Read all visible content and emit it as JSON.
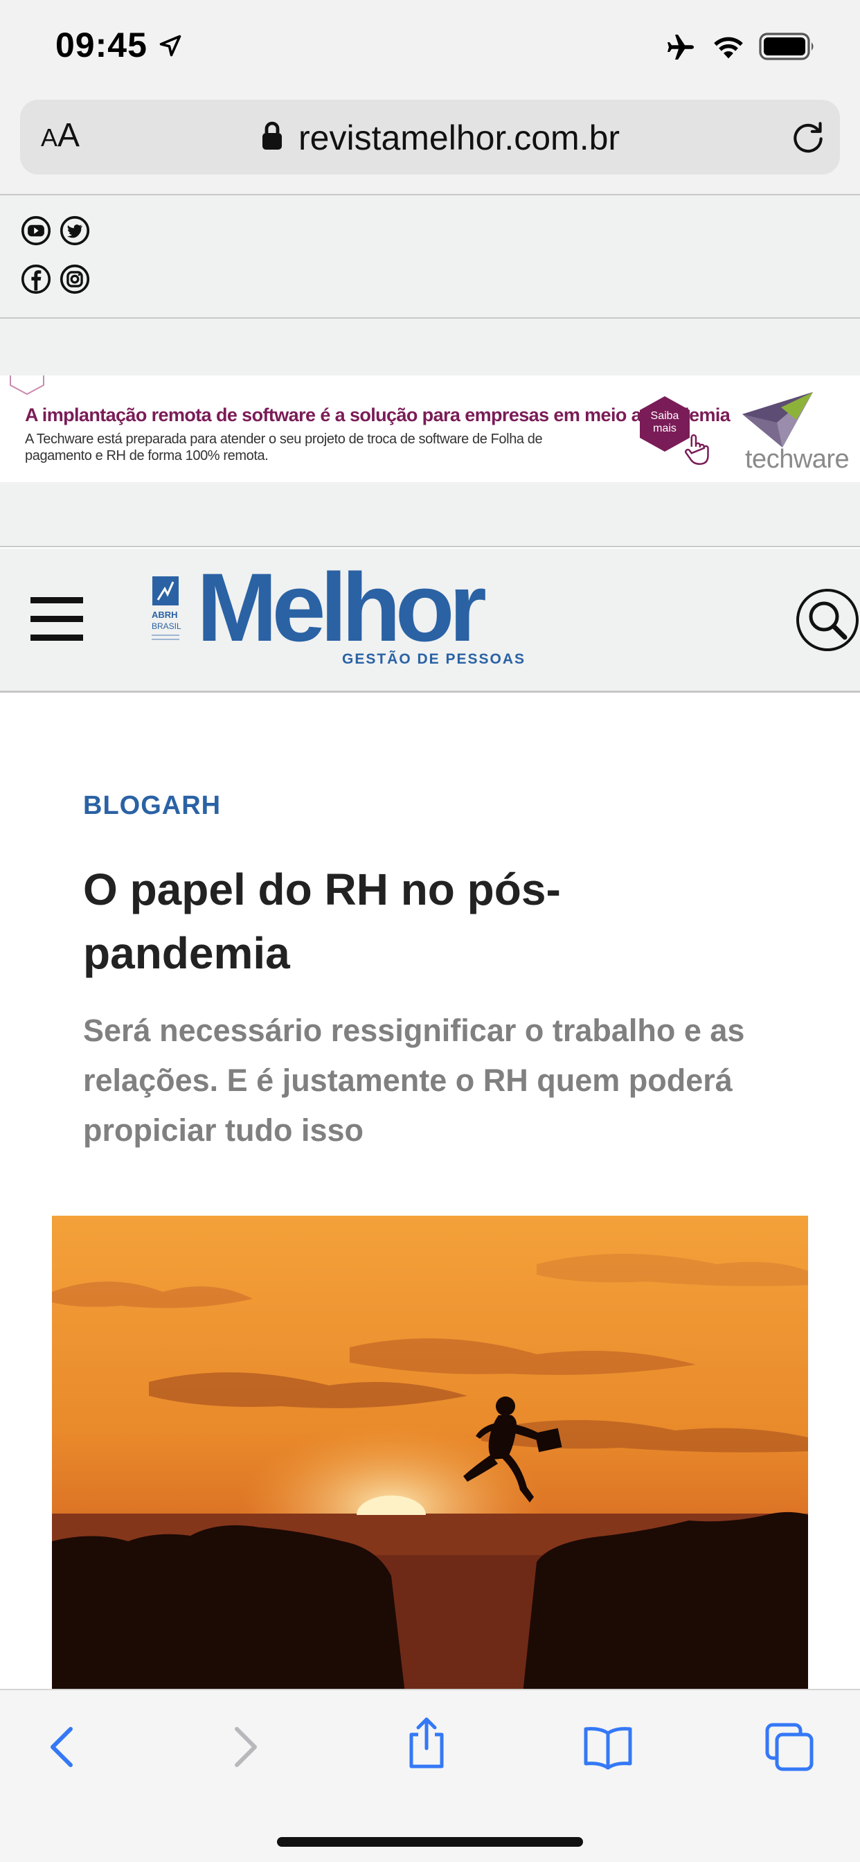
{
  "status_bar": {
    "time": "09:45",
    "icons": [
      "location-arrow-icon",
      "airplane-icon",
      "wifi-icon",
      "battery-icon"
    ]
  },
  "browser": {
    "text_size_button": {
      "small": "A",
      "large": "A"
    },
    "url": "revistamelhor.com.br",
    "icons": [
      "lock-icon",
      "reload-icon"
    ]
  },
  "social": [
    "youtube-icon",
    "twitter-icon",
    "facebook-icon",
    "instagram-icon"
  ],
  "ad": {
    "headline": "A implantação remota de software é a solução para empresas em meio a pandemia",
    "body": "A Techware está preparada para atender o seu projeto de troca de software de Folha de pagamento e RH de forma 100% remota.",
    "cta": "Saiba mais",
    "brand": "techware",
    "colors": {
      "headline": "#7a1c57",
      "cta_bg": "#7a1c57"
    }
  },
  "site": {
    "logo_badge": "ABRH BRASIL",
    "logo": "Melhor",
    "logo_tagline": "GESTÃO DE PESSOAS",
    "brand_color": "#2a62a4"
  },
  "article": {
    "category": "BLOGARH",
    "title": "O papel do RH no pós-pandemia",
    "title_line1": "O papel do RH no pós-",
    "title_line2": "pandemia",
    "subtitle": "Será necessário ressignificar o trabalho e as relações. E é justamente o RH quem poderá propiciar tudo isso",
    "hero_image": "man leaping between cliffs at sunset with briefcase"
  },
  "toolbar": {
    "buttons": [
      "back-icon",
      "forward-icon",
      "share-icon",
      "bookmarks-icon",
      "tabs-icon"
    ],
    "colors": {
      "active": "#3478f6",
      "disabled": "#b8b8bc"
    }
  }
}
